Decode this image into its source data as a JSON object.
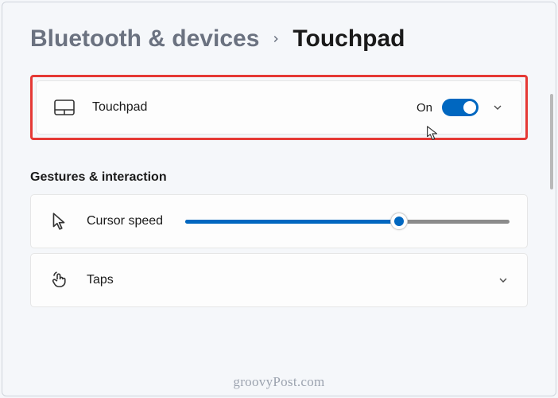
{
  "breadcrumb": {
    "parent": "Bluetooth & devices",
    "current": "Touchpad"
  },
  "touchpad_card": {
    "label": "Touchpad",
    "state_label": "On"
  },
  "section": {
    "title": "Gestures & interaction"
  },
  "cursor_speed": {
    "label": "Cursor speed",
    "value_percent": 66
  },
  "taps": {
    "label": "Taps"
  },
  "watermark": "groovyPost.com"
}
